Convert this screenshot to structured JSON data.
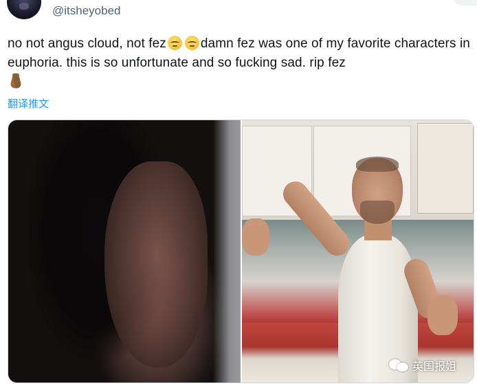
{
  "tweet": {
    "handle": "@itsheyobed",
    "text_part1": "no not angus cloud, not fez",
    "text_part2": "damn fez was one of my favorite characters in euphoria. this is so unfortunate and so fucking sad. rip fez",
    "emojis": [
      "pensive-face",
      "pensive-face",
      "folded-hands"
    ],
    "translate_label": "翻译推文"
  },
  "media": {
    "images": [
      {
        "icon": "crying-woman-photo"
      },
      {
        "icon": "smiling-man-tank-top-photo"
      }
    ]
  },
  "watermark": {
    "text": "英国报姐",
    "icon": "wechat-icon"
  }
}
